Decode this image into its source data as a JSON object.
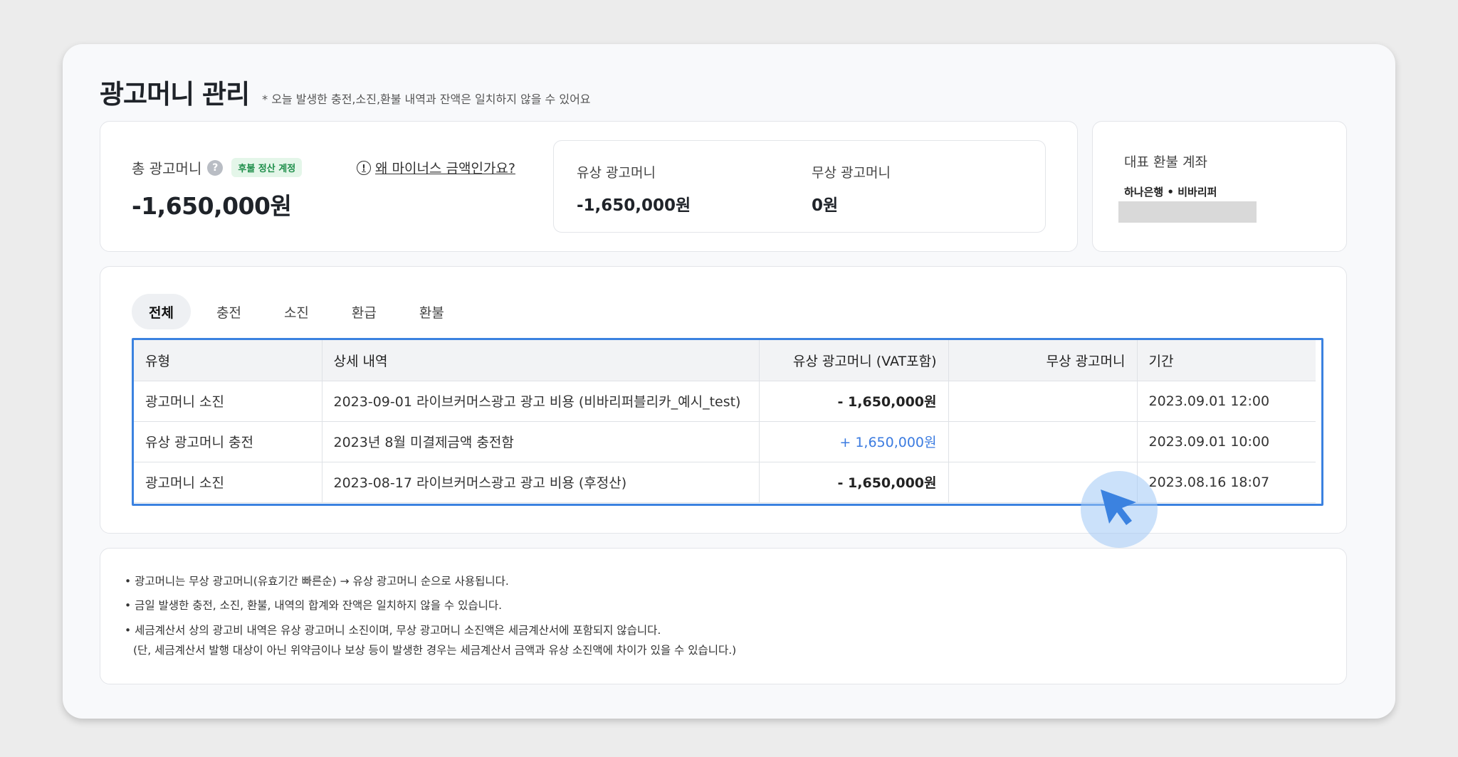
{
  "page": {
    "title": "광고머니 관리",
    "note": "* 오늘 발생한 충전,소진,환불 내역과 잔액은 일치하지 않을 수 있어요"
  },
  "summary": {
    "total_label": "총 광고머니",
    "help_icon": "?",
    "badge": "후불 정산 계정",
    "why_link": "왜 마이너스 금액인가요?",
    "info_icon": "!",
    "total_amount": "-1,650,000원",
    "paid_label": "유상 광고머니",
    "paid_amount": "-1,650,000원",
    "free_label": "무상 광고머니",
    "free_amount": "0원"
  },
  "refund": {
    "title": "대표 환불 계좌",
    "bank": "하나은행 • 비바리퍼"
  },
  "tabs": [
    {
      "label": "전체",
      "active": true
    },
    {
      "label": "충전",
      "active": false
    },
    {
      "label": "소진",
      "active": false
    },
    {
      "label": "환급",
      "active": false
    },
    {
      "label": "환불",
      "active": false
    }
  ],
  "table": {
    "headers": [
      "유형",
      "상세 내역",
      "유상 광고머니 (VAT포함)",
      "무상 광고머니",
      "기간"
    ],
    "rows": [
      [
        "광고머니 소진",
        "2023-09-01 라이브커머스광고 광고 비용 (비바리퍼블리카_예시_test)",
        "- 1,650,000원",
        "",
        "2023.09.01 12:00"
      ],
      [
        "유상 광고머니 충전",
        "2023년 8월 미결제금액 충전함",
        "+ 1,650,000원",
        "",
        "2023.09.01 10:00"
      ],
      [
        "광고머니 소진",
        "2023-08-17 라이브커머스광고 광고 비용 (후정산)",
        "- 1,650,000원",
        "",
        "2023.08.16 18:07"
      ]
    ]
  },
  "notes": [
    "• 광고머니는 무상 광고머니(유효기간 빠른순) → 유상 광고머니 순으로 사용됩니다.",
    "• 금일 발생한 충전, 소진, 환불, 내역의 합계와 잔액은 일치하지 않을 수 있습니다.",
    "• 세금계산서 상의 광고비 내역은 유상 광고머니 소진이며, 무상 광고머니 소진액은 세금계산서에 포함되지 않습니다.",
    "(단, 세금계산서 발행 대상이 아닌 위약금이나 보상 등이 발생한 경우는 세금계산서 금액과 유상 소진액에 차이가 있을 수 있습니다.)"
  ],
  "colors": {
    "accent": "#3b82e0",
    "plus_amount": "#3b7be0",
    "badge_text": "#1e8e4a",
    "badge_bg": "#e4f6e9"
  },
  "icons": [
    "help-icon",
    "info-icon",
    "cursor-icon"
  ]
}
